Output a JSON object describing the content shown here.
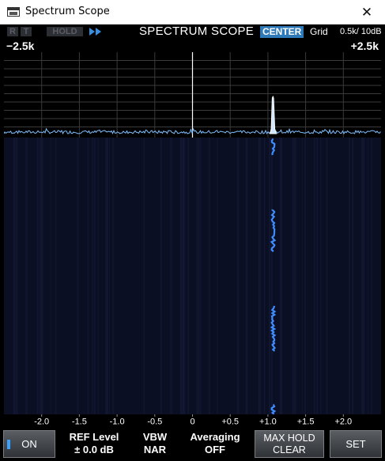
{
  "window": {
    "title": "Spectrum Scope",
    "close_glyph": "✕",
    "icon": "app-window-icon"
  },
  "status": {
    "r_tag": "R",
    "t_tag": "T",
    "hold_tag": "HOLD",
    "speed_icon": "double-chevron-right-icon",
    "scope_title": "SPECTRUM SCOPE",
    "mode": "CENTER",
    "grid_label": "Grid",
    "grid_value": "0.5k/ 10dB",
    "span_left": "−2.5k",
    "span_right": "+2.5k"
  },
  "frequency_axis": {
    "unit": "kHz",
    "labels": [
      "-2.0",
      "-1.5",
      "-1.0",
      "-0.5",
      "0",
      "+0.5",
      "+1.0",
      "+1.5",
      "+2.0"
    ],
    "values": [
      -2.0,
      -1.5,
      -1.0,
      -0.5,
      0,
      0.5,
      1.0,
      1.5,
      2.0
    ],
    "range": [
      -2.5,
      2.5
    ]
  },
  "signal": {
    "peak_offset_khz": 1.07
  },
  "colors": {
    "waterfall_bg": "#0b0f24",
    "spectrum_trace": "#7fc0ff",
    "waterfall_signal": "#3f8cff",
    "center_marker": "#ffffff",
    "grid": "#3a3a3a"
  },
  "controls": {
    "on_button": "ON",
    "ref_level_label": "REF Level",
    "ref_level_value": "± 0.0 dB",
    "vbw_label": "VBW",
    "vbw_value": "NAR",
    "averaging_label": "Averaging",
    "averaging_value": "OFF",
    "max_hold_line1": "MAX HOLD",
    "max_hold_line2": "CLEAR",
    "set_button": "SET"
  }
}
